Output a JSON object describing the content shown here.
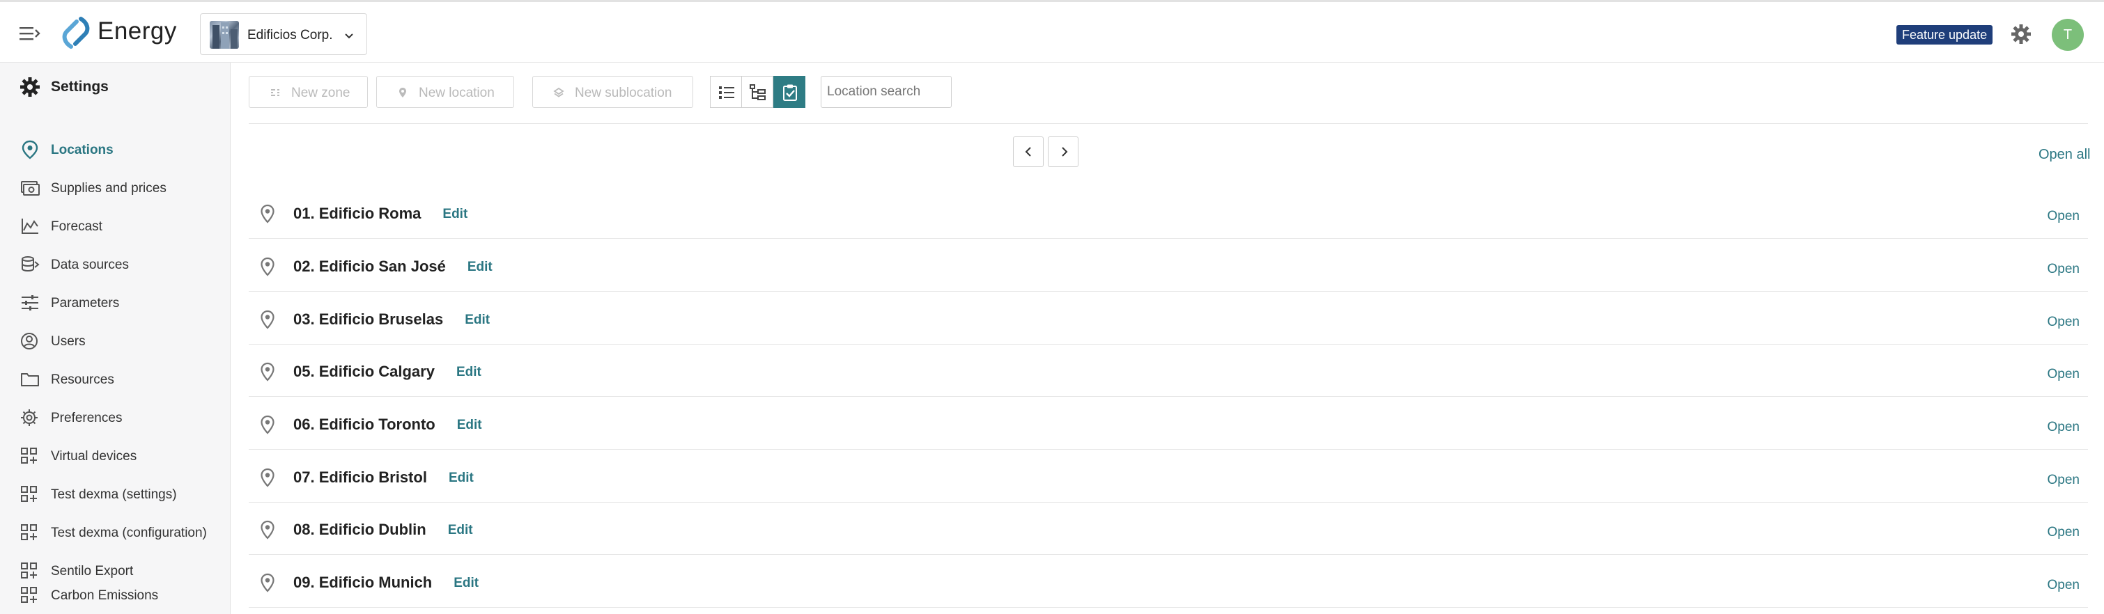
{
  "brand": {
    "name": "Energy",
    "accent": "#2a7682",
    "brand_blue": "#1f3e7a",
    "avatar_green": "#7cbf7a"
  },
  "header": {
    "organization": "Edificios Corp.",
    "feature_badge": "Feature update",
    "avatar_initial": "T",
    "icons": [
      "hamburger-icon",
      "logo-icon",
      "chevron-down-icon",
      "gear-icon"
    ]
  },
  "sidebar": {
    "title": "Settings",
    "items": [
      {
        "label": "Locations",
        "icon": "map-pin-icon",
        "active": true
      },
      {
        "label": "Supplies and prices",
        "icon": "money-icon"
      },
      {
        "label": "Forecast",
        "icon": "chart-icon"
      },
      {
        "label": "Data sources",
        "icon": "database-icon"
      },
      {
        "label": "Parameters",
        "icon": "sliders-icon"
      },
      {
        "label": "Users",
        "icon": "user-circle-icon"
      },
      {
        "label": "Resources",
        "icon": "folder-icon"
      },
      {
        "label": "Preferences",
        "icon": "gear-icon"
      },
      {
        "label": "Virtual devices",
        "icon": "apps-icon"
      },
      {
        "label": "Test dexma (settings)",
        "icon": "apps-icon"
      },
      {
        "label": "Test dexma (configuration)",
        "icon": "apps-icon"
      },
      {
        "label": "Sentilo Export",
        "icon": "apps-icon"
      },
      {
        "label": "Carbon Emissions",
        "icon": "apps-icon"
      }
    ]
  },
  "toolbar": {
    "new_zone": "New zone",
    "new_location": "New location",
    "new_sublocation": "New sublocation",
    "search_placeholder": "Location search"
  },
  "list": {
    "open_all": "Open all",
    "edit_label": "Edit",
    "open_label": "Open",
    "locations": [
      "01. Edificio Roma",
      "02. Edificio San José",
      "03. Edificio Bruselas",
      "05. Edificio Calgary",
      "06. Edificio Toronto",
      "07. Edificio Bristol",
      "08. Edificio Dublin",
      "09. Edificio Munich"
    ]
  }
}
